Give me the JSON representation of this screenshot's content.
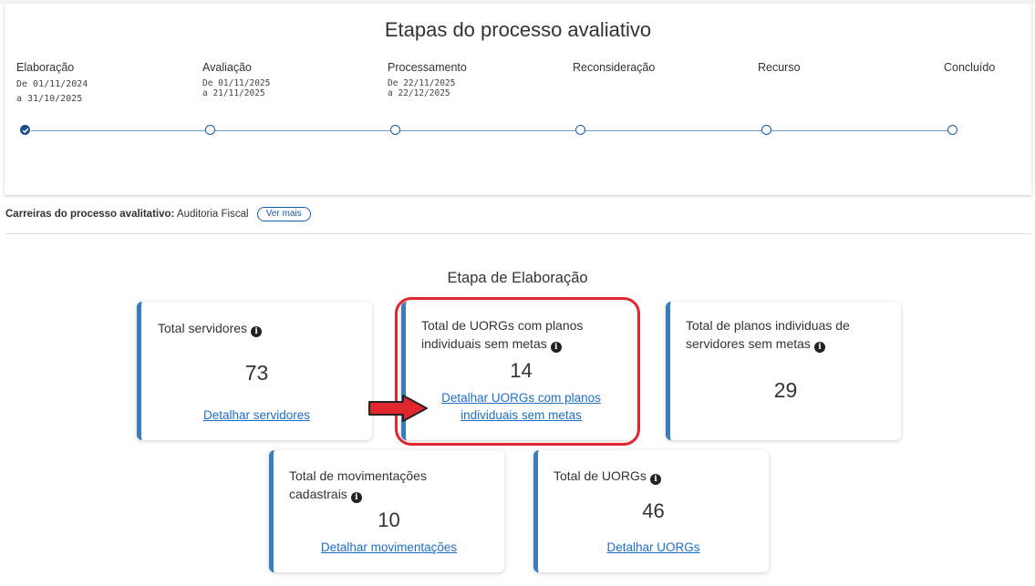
{
  "stages": {
    "title": "Etapas do processo avaliativo",
    "items": [
      {
        "name": "Elaboração",
        "dates_line1": "De 01/11/2024",
        "dates_line2": "a  31/10/2025",
        "done": true
      },
      {
        "name": "Avaliação",
        "dates_line1": "De 01/11/2025",
        "dates_line2": "a  21/11/2025",
        "done": false
      },
      {
        "name": "Processamento",
        "dates_line1": "De 22/11/2025",
        "dates_line2": "a  22/12/2025",
        "done": false
      },
      {
        "name": "Reconsideração",
        "dates_line1": "",
        "dates_line2": "",
        "done": false
      },
      {
        "name": "Recurso",
        "dates_line1": "",
        "dates_line2": "",
        "done": false
      },
      {
        "name": "Concluído",
        "dates_line1": "",
        "dates_line2": "",
        "done": false
      }
    ]
  },
  "careers": {
    "label": "Carreiras do processo avalitativo:",
    "value": "Auditoria Fiscal",
    "button": "Ver mais"
  },
  "section": {
    "title": "Etapa de Elaboração"
  },
  "cards": {
    "servidores": {
      "label": "Total servidores",
      "value": "73",
      "link": "Detalhar servidores"
    },
    "uorgs_sem_metas": {
      "label_line1": "Total de UORGs com planos",
      "label_line2": "individuais sem metas",
      "value": "14",
      "link_line1": "Detalhar UORGs com planos",
      "link_line2": "individuais sem metas"
    },
    "planos_sem_metas": {
      "label_line1": "Total de planos individuas de",
      "label_line2": "servidores sem metas",
      "value": "29"
    },
    "movimentacoes": {
      "label_line1": "Total de movimentações",
      "label_line2": "cadastrais",
      "value": "10",
      "link": "Detalhar movimentações"
    },
    "uorgs": {
      "label": "Total de UORGs",
      "value": "46",
      "link": "Detalhar UORGs"
    }
  },
  "colors": {
    "accent": "#3b7dba",
    "link": "#1f6fc7",
    "highlight": "#e1262d",
    "arrow": "#e1262d"
  },
  "icons": {
    "info": "info-circle-icon",
    "check": "check-icon",
    "arrow": "right-arrow-icon"
  }
}
